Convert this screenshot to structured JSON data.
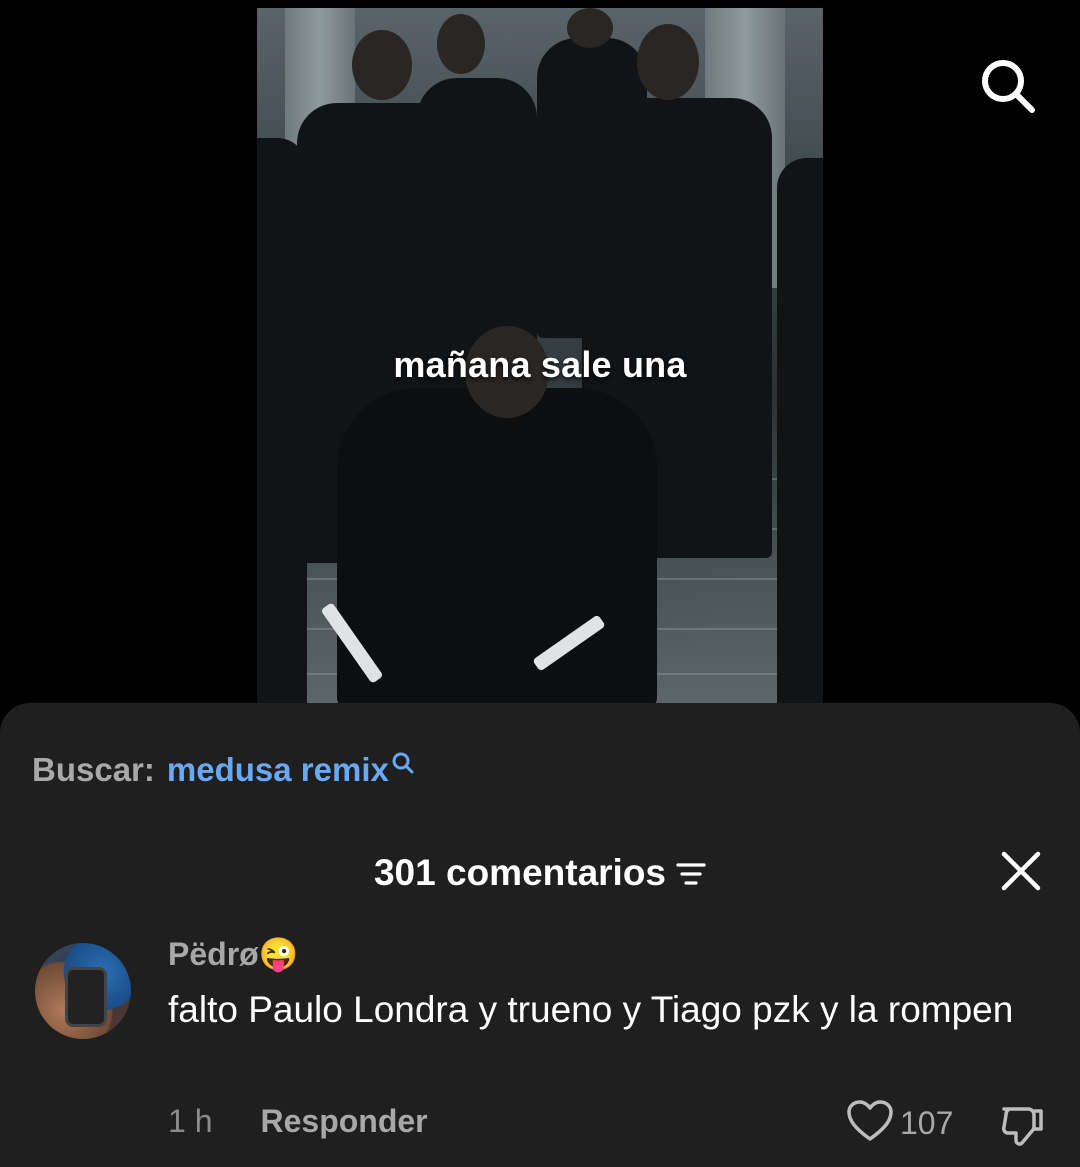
{
  "video": {
    "caption": "mañana sale una"
  },
  "icons": {
    "top_search": "search-icon",
    "suggest_search": "search-icon",
    "sort": "sort-icon",
    "close": "close-icon",
    "like": "heart-icon",
    "dislike": "thumbs-down-icon"
  },
  "search_suggestion": {
    "label": "Buscar:",
    "query": "medusa remix"
  },
  "comments_header": {
    "count_label": "301 comentarios"
  },
  "comment": {
    "username": "Pëdrø",
    "emoji": "😜",
    "text": "falto Paulo Londra y trueno y Tiago pzk y la rompen",
    "time": "1 h",
    "reply_label": "Responder",
    "likes": "107"
  },
  "colors": {
    "sheet_bg": "#1f1f1f",
    "link_blue": "#69a8f5",
    "muted_text": "#a8a8a8"
  }
}
